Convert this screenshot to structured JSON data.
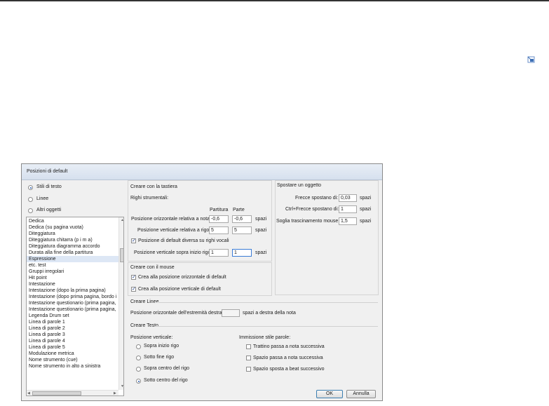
{
  "dialog": {
    "title": "Posizioni di default",
    "object_types": [
      {
        "label": "Stili di testo",
        "selected": true
      },
      {
        "label": "Linee",
        "selected": false
      },
      {
        "label": "Altri oggetti",
        "selected": false
      }
    ],
    "style_list": [
      "Dedica",
      "Dedica (su pagina vuota)",
      "Diteggiatura",
      "Diteggiatura chitarra (p i m a)",
      "Diteggiatura diagramma accordo",
      "Durata alla fine della partitura",
      "Espressione",
      "etc. test",
      "Gruppi irregolari",
      "Hit point",
      "Intestazione",
      "Intestazione (dopo la prima pagina)",
      "Intestazione (dopo prima pagina, bordo i",
      "Intestazione questionario (prima pagina,",
      "Intestazione questionario (prima pagina,",
      "Legenda Drum set",
      "Linea di parole 1",
      "Linea di parole 2",
      "Linea di parole 3",
      "Linea di parole 4",
      "Linea di parole 5",
      "Modulazione metrica",
      "Nome strumento (cue)",
      "Nome strumento in alto a sinistra"
    ],
    "style_list_selected": "Espressione",
    "keyboard": {
      "heading": "Creare con la tastiera",
      "subheading": "Righi strumentali:",
      "col_partitura": "Partitura",
      "col_parte": "Parte",
      "horiz_label": "Posizione orizzontale relativa a nota:",
      "horiz_partitura": "-0,6",
      "horiz_parte": "-0,6",
      "vert_label": "Posizione verticale relativa a rigo:",
      "vert_partitura": "5",
      "vert_parte": "5",
      "units": "spazi",
      "vocal_check_label": "Posizione di default diversa su righi vocali",
      "vocal_checked": true,
      "vert_top_label": "Posizione verticale sopra inizio rigo:",
      "vert_top_partitura": "1",
      "vert_top_parte": "1"
    },
    "mouse": {
      "heading": "Creare con il mouse",
      "horiz_default_label": "Crea alla posizione orizzontale di default",
      "horiz_default_checked": true,
      "vert_default_label": "Crea alla posizione verticale di default",
      "vert_default_checked": true
    },
    "move": {
      "heading": "Spostare un oggetto",
      "arrows_label": "Frecce spostano di:",
      "arrows_value": "0,03",
      "ctrl_label": "Ctrl+Frecce spostano di:",
      "ctrl_value": "1",
      "drag_label": "Soglia trascinamento mouse:",
      "drag_value": "1,5",
      "units": "spazi"
    },
    "lines": {
      "heading": "Creare Linee",
      "end_label": "Posizione orizzontale dell'estremità destra:",
      "end_value": "",
      "end_suffix": "spazi a destra della nota"
    },
    "text": {
      "heading": "Creare Testo",
      "vertical_heading": "Posizione verticale:",
      "vertical_options": [
        {
          "label": "Sopra inizio rigo",
          "selected": false
        },
        {
          "label": "Sotto fine rigo",
          "selected": false
        },
        {
          "label": "Sopra centro del rigo",
          "selected": false
        },
        {
          "label": "Sotto centro del rigo",
          "selected": true
        }
      ],
      "lyrics_heading": "Immissione stile parole:",
      "lyrics_options": [
        {
          "label": "Trattino passa a nota successiva",
          "checked": false
        },
        {
          "label": "Spazio passa a nota successiva",
          "checked": false
        },
        {
          "label": "Spazio sposta a beat successivo",
          "checked": false
        }
      ]
    },
    "buttons": {
      "ok": "OK",
      "cancel": "Annulla"
    }
  }
}
